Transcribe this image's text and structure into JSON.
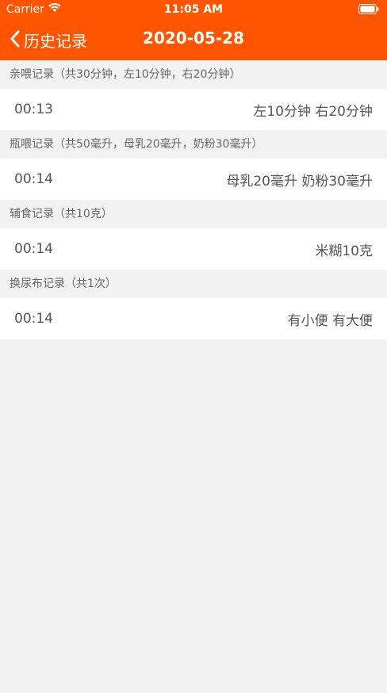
{
  "status": {
    "carrier": "Carrier",
    "time": "11:05 AM"
  },
  "nav": {
    "back_label": "历史记录",
    "title": "2020-05-28"
  },
  "sections": [
    {
      "header": "亲喂记录（共30分钟，左10分钟，右20分钟）",
      "rows": [
        {
          "time": "00:13",
          "detail": "左10分钟 右20分钟"
        }
      ]
    },
    {
      "header": "瓶喂记录（共50毫升，母乳20毫升，奶粉30毫升）",
      "rows": [
        {
          "time": "00:14",
          "detail": "母乳20毫升 奶粉30毫升"
        }
      ]
    },
    {
      "header": "辅食记录（共10克）",
      "rows": [
        {
          "time": "00:14",
          "detail": "米糊10克"
        }
      ]
    },
    {
      "header": "换尿布记录（共1次）",
      "rows": [
        {
          "time": "00:14",
          "detail": "有小便 有大便"
        }
      ]
    }
  ]
}
